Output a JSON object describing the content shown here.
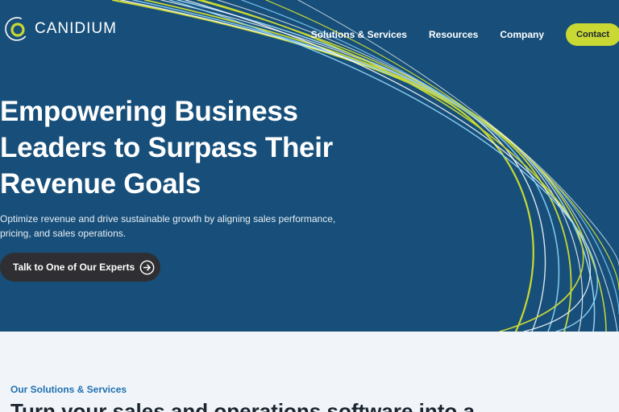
{
  "brand": {
    "name": "CANIDIUM",
    "logo_icon": "canidium-logo-icon"
  },
  "nav": {
    "items": [
      "Solutions & Services",
      "Resources",
      "Company"
    ],
    "contact_label": "Contact"
  },
  "hero": {
    "headline_lines": [
      "Empowering Business",
      "Leaders to Surpass Their",
      "Revenue Goals"
    ],
    "subheadline_lines": [
      "Optimize revenue and drive sustainable growth by aligning sales performance,",
      "pricing, and sales operations."
    ],
    "cta_label": "Talk to One of Our Experts",
    "cta_icon": "arrow-right-circle-icon"
  },
  "section": {
    "eyebrow": "Our Solutions & Services",
    "title": "Turn your sales and operations software into a"
  },
  "colors": {
    "hero_bg": "#174f7a",
    "accent": "#c9d833",
    "cta_bg": "#2f2f33",
    "eyebrow": "#1f6fb0",
    "page_bg": "#f1f5f9"
  }
}
